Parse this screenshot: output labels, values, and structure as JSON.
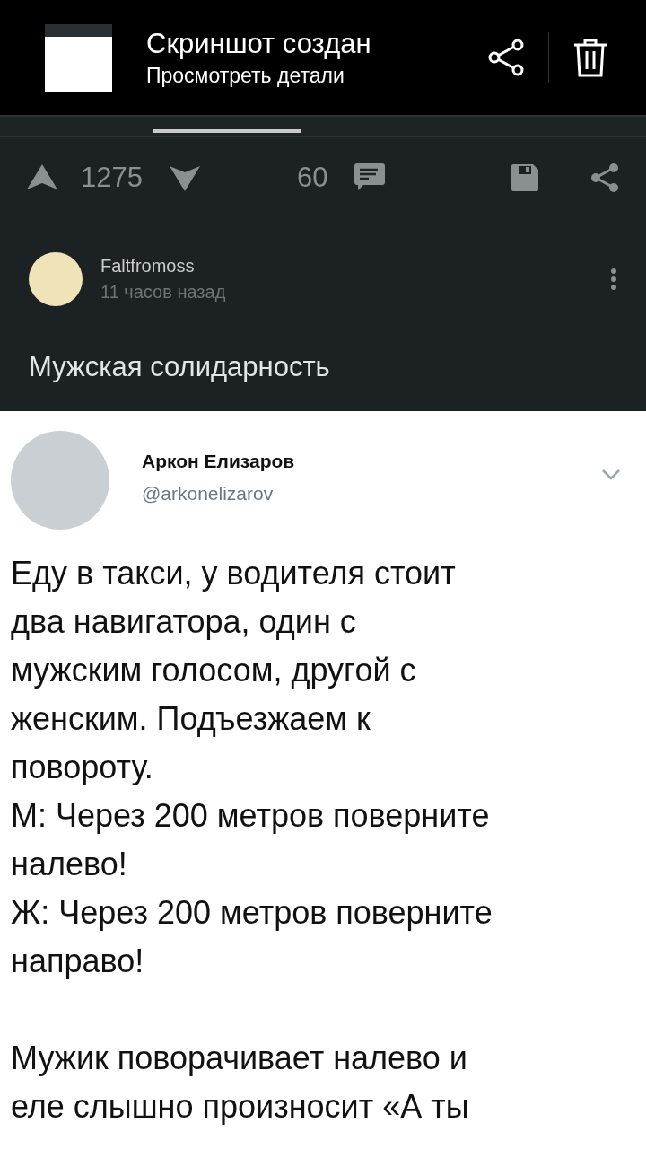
{
  "notification": {
    "title": "Скриншот создан",
    "subtitle": "Просмотреть детали"
  },
  "actions": {
    "rating": "1275",
    "comments": "60"
  },
  "post": {
    "author": "Faltfromoss",
    "time": "11 часов назад",
    "title": "Мужская солидарность"
  },
  "tweet": {
    "name": "Аркон Елизаров",
    "handle": "@arkonelizarov",
    "paragraphs": [
      {
        "lines": [
          "Еду в такси, у водителя стоит",
          "два навигатора, один с",
          "мужским голосом, другой с",
          "женским. Подъезжаем к",
          "повороту.",
          "М: Через 200 метров поверните",
          "налево!",
          "Ж: Через 200 метров поверните",
          "направо!"
        ]
      },
      {
        "lines": [
          "Мужик поворачивает налево и",
          "еле слышно произносит «А ты"
        ]
      }
    ]
  }
}
